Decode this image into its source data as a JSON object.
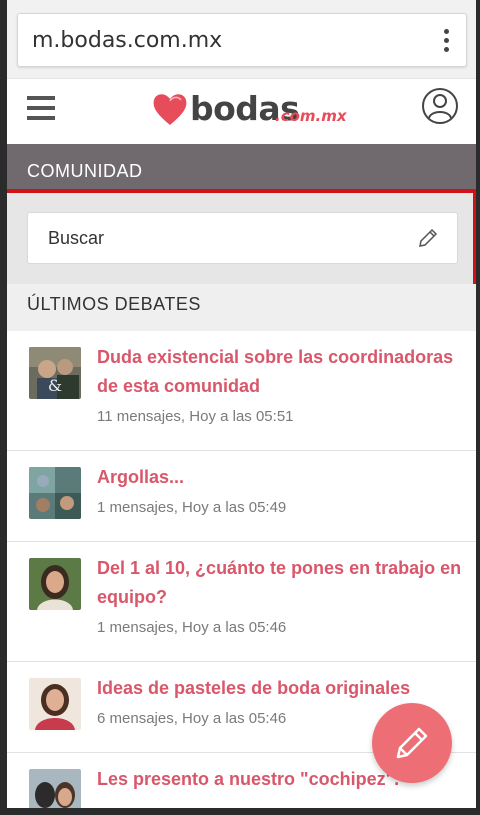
{
  "browser": {
    "url": "m.bodas.com.mx"
  },
  "header": {
    "logo_text": "bodas",
    "logo_suffix": ".com.mx"
  },
  "community": {
    "title": "COMUNIDAD"
  },
  "search": {
    "placeholder": "Buscar"
  },
  "section": {
    "title": "ÚLTIMOS DEBATES"
  },
  "debates": [
    {
      "title": "Duda existencial sobre las coordinadoras de esta comunidad",
      "meta": "11 mensajes, Hoy a las 05:51"
    },
    {
      "title": "Argollas...",
      "meta": "1 mensajes, Hoy a las 05:49"
    },
    {
      "title": "Del 1 al 10, ¿cuánto te pones en trabajo en equipo?",
      "meta": "1 mensajes, Hoy a las 05:46"
    },
    {
      "title": "Ideas de pasteles de boda originales",
      "meta": "6 mensajes, Hoy a las 05:46"
    },
    {
      "title": "Les presento a nuestro \"cochipez\".",
      "meta": ""
    }
  ],
  "colors": {
    "accent": "#d9576a",
    "community_bar": "#706a6f",
    "fab": "#ee6e76",
    "highlight": "#d0111a"
  }
}
